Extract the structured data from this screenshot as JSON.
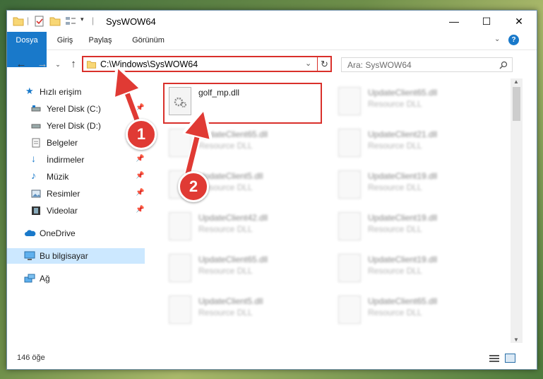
{
  "window": {
    "title": "SysWOW64",
    "controls": {
      "minimize": "—",
      "maximize": "☐",
      "close": "✕"
    }
  },
  "ribbon": {
    "tabs": [
      {
        "label": "Dosya"
      },
      {
        "label": "Giriş"
      },
      {
        "label": "Paylaş"
      },
      {
        "label": "Görünüm"
      }
    ]
  },
  "address": {
    "path": "C:\\Windows\\SysWOW64"
  },
  "search": {
    "placeholder": "Ara: SysWOW64"
  },
  "sidebar": {
    "items": [
      {
        "label": "Hızlı erişim",
        "icon": "star-icon"
      },
      {
        "label": "Yerel Disk (C:)",
        "icon": "drive-icon"
      },
      {
        "label": "Yerel Disk (D:)",
        "icon": "drive-icon"
      },
      {
        "label": "Belgeler",
        "icon": "documents-icon"
      },
      {
        "label": "İndirmeler",
        "icon": "download-icon"
      },
      {
        "label": "Müzik",
        "icon": "music-icon"
      },
      {
        "label": "Resimler",
        "icon": "pictures-icon"
      },
      {
        "label": "Videolar",
        "icon": "videos-icon"
      },
      {
        "label": "OneDrive",
        "icon": "cloud-icon"
      },
      {
        "label": "Bu bilgisayar",
        "icon": "computer-icon"
      },
      {
        "label": "Ağ",
        "icon": "network-icon"
      }
    ]
  },
  "files": [
    {
      "name": "golf_mp.dll",
      "type": ""
    },
    {
      "name": "UpdateClient65.dll",
      "type": "Resource DLL"
    },
    {
      "name": "UpdateClient65.dll",
      "type": "Resource DLL"
    },
    {
      "name": "UpdateClient21.dll",
      "type": "Resource DLL"
    },
    {
      "name": "UpdateClient5.dll",
      "type": "Resource DLL"
    },
    {
      "name": "UpdateClient19.dll",
      "type": "Resource DLL"
    },
    {
      "name": "UpdateClient42.dll",
      "type": "Resource DLL"
    },
    {
      "name": "UpdateClient19.dll",
      "type": "Resource DLL"
    },
    {
      "name": "UpdateClient65.dll",
      "type": "Resource DLL"
    },
    {
      "name": "UpdateClient19.dll",
      "type": "Resource DLL"
    },
    {
      "name": "UpdateClient5.dll",
      "type": "Resource DLL"
    },
    {
      "name": "UpdateClient65.dll",
      "type": "Resource DLL"
    }
  ],
  "status": {
    "count": "146 öğe"
  },
  "annotations": [
    {
      "label": "1"
    },
    {
      "label": "2"
    }
  ],
  "colors": {
    "accent": "#1979ca",
    "highlight": "#d9302b",
    "selection": "#cce8ff"
  }
}
